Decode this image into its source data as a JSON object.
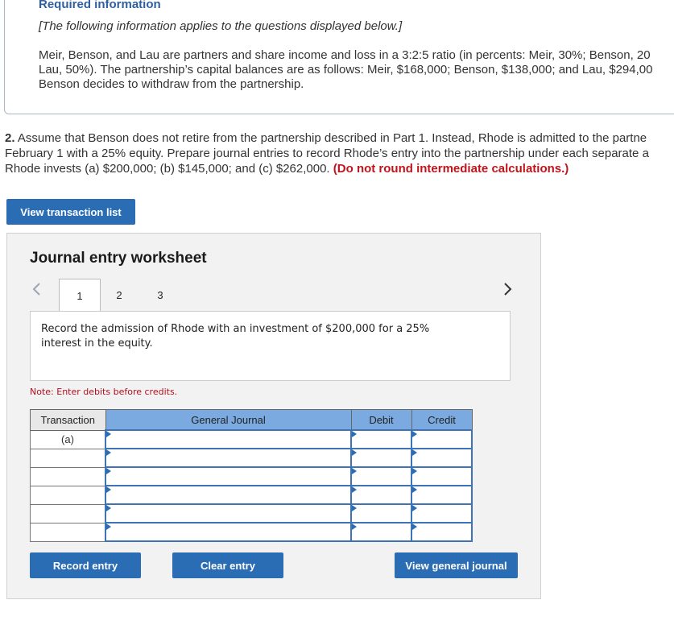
{
  "header": {
    "title": "Required information",
    "bracket_note": "[The following information applies to the questions displayed below.]",
    "info_lines": [
      "Meir, Benson, and Lau are partners and share income and loss in a 3:2:5 ratio (in percents: Meir, 30%; Benson, 20",
      "Lau, 50%). The partnership’s capital balances are as follows: Meir, $168,000; Benson, $138,000; and Lau, $294,00",
      "Benson decides to withdraw from the partnership."
    ]
  },
  "question": {
    "number": "2.",
    "line1": " Assume that Benson does not retire from the partnership described in Part 1. Instead, Rhode is admitted to the partne",
    "line2": "February 1 with a 25% equity. Prepare journal entries to record Rhode’s entry into the partnership under each separate a",
    "line3": "Rhode invests (a) $200,000; (b) $145,000; and (c) $262,000.",
    "emphasis": "(Do not round intermediate calculations.)"
  },
  "buttons": {
    "view_transaction_list": "View transaction list",
    "record_entry": "Record entry",
    "clear_entry": "Clear entry",
    "view_general_journal": "View general journal"
  },
  "worksheet": {
    "title": "Journal entry worksheet",
    "tabs": [
      "1",
      "2",
      "3"
    ],
    "active_tab": "1",
    "instruction": "Record the admission of Rhode with an investment of $200,000 for a 25% interest in the equity.",
    "note": "Note: Enter debits before credits."
  },
  "table": {
    "headers": {
      "transaction": "Transaction",
      "general_journal": "General Journal",
      "debit": "Debit",
      "credit": "Credit"
    },
    "rows": [
      {
        "transaction": "(a)",
        "account": "",
        "debit": "",
        "credit": ""
      },
      {
        "transaction": "",
        "account": "",
        "debit": "",
        "credit": ""
      },
      {
        "transaction": "",
        "account": "",
        "debit": "",
        "credit": ""
      },
      {
        "transaction": "",
        "account": "",
        "debit": "",
        "credit": ""
      },
      {
        "transaction": "",
        "account": "",
        "debit": "",
        "credit": ""
      },
      {
        "transaction": "",
        "account": "",
        "debit": "",
        "credit": ""
      }
    ]
  },
  "icons": {
    "prev": "chevron-left-icon",
    "next": "chevron-right-icon"
  },
  "colors": {
    "button_blue": "#2b6db4",
    "header_blue": "#7aaae0",
    "emphasis_red": "#c0141c",
    "title_blue": "#2f5f9c"
  }
}
